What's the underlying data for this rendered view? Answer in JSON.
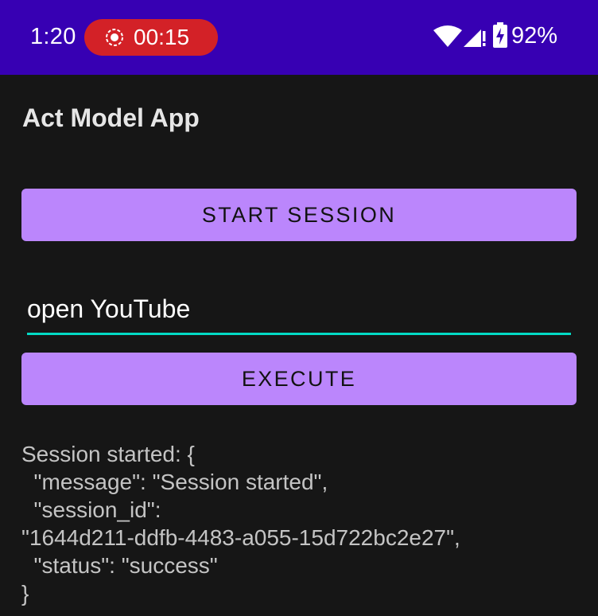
{
  "status_bar": {
    "time": "1:20",
    "recording": {
      "time": "00:15",
      "icon": "screen-record-icon",
      "color": "#d32127"
    },
    "icons": [
      "wifi-icon",
      "signal-icon",
      "battery-charging-icon"
    ],
    "battery_percent": "92%",
    "color": "#3700b3"
  },
  "app": {
    "title": "Act Model App",
    "start_button_label": "START SESSION",
    "command_input_value": "open YouTube",
    "execute_button_label": "EXECUTE",
    "accent_color": "#bb86fc",
    "input_underline_color": "#03dac5"
  },
  "output": {
    "lines": [
      "Session started: {",
      "  \"message\": \"Session started\",",
      "  \"session_id\":",
      "\"1644d211-ddfb-4483-a055-15d722bc2e27\",",
      "  \"status\": \"success\"",
      "}"
    ]
  }
}
